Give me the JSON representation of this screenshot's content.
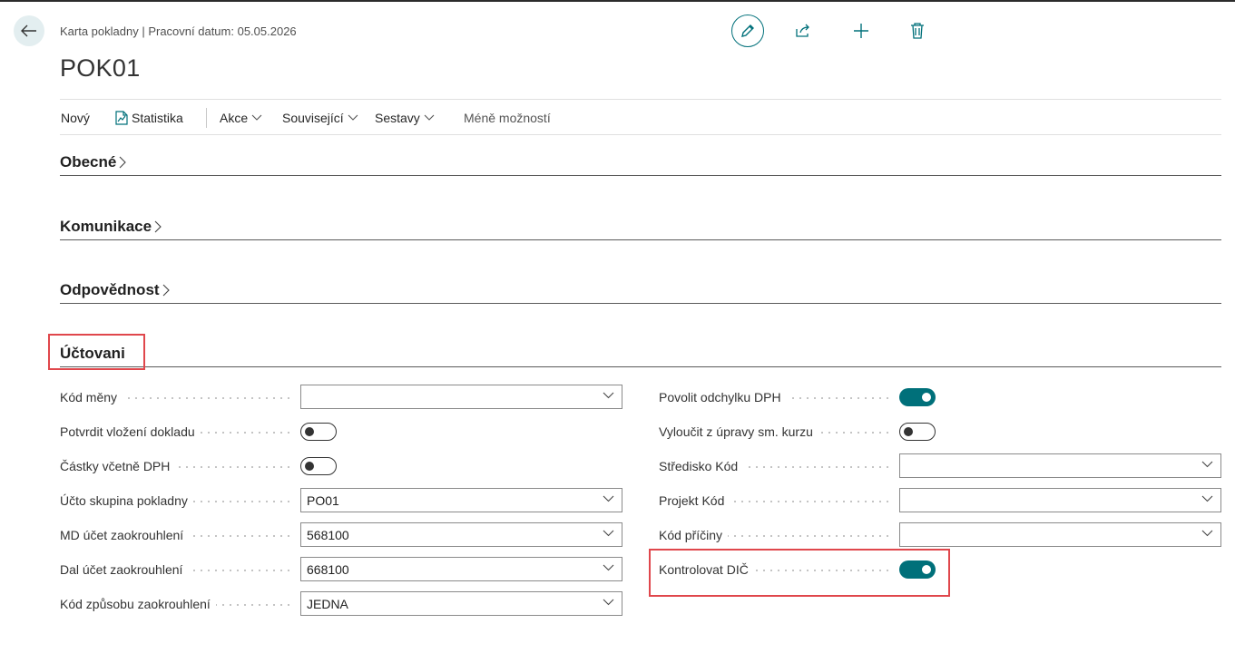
{
  "header": {
    "caption": "Karta pokladny | Pracovní datum: 05.05.2026",
    "title": "POK01"
  },
  "toolbar_icons": [
    "pencil-icon",
    "share-icon",
    "plus-icon",
    "trash-icon"
  ],
  "actions": {
    "new": "Nový",
    "statistics": "Statistika",
    "actions": "Akce",
    "related": "Související",
    "reports": "Sestavy",
    "fewer_options": "Méně možností"
  },
  "sections": {
    "general": "Obecné",
    "communication": "Komunikace",
    "responsibility": "Odpovědnost",
    "posting": "Účtovani"
  },
  "posting": {
    "left": [
      {
        "label": "Kód měny",
        "type": "select",
        "value": ""
      },
      {
        "label": "Potvrdit vložení dokladu",
        "type": "toggle",
        "value": false
      },
      {
        "label": "Částky včetně DPH",
        "type": "toggle",
        "value": false
      },
      {
        "label": "Účto skupina pokladny",
        "type": "select",
        "value": "PO01"
      },
      {
        "label": "MD účet zaokrouhlení",
        "type": "select",
        "value": "568100"
      },
      {
        "label": "Dal účet zaokrouhlení",
        "type": "select",
        "value": "668100"
      },
      {
        "label": "Kód způsobu zaokrouhlení",
        "type": "select",
        "value": "JEDNA"
      }
    ],
    "right": [
      {
        "label": "Povolit odchylku DPH",
        "type": "toggle",
        "value": true
      },
      {
        "label": "Vyloučit z úpravy sm. kurzu",
        "type": "toggle",
        "value": false
      },
      {
        "label": "Středisko Kód",
        "type": "select",
        "value": ""
      },
      {
        "label": "Projekt Kód",
        "type": "select",
        "value": ""
      },
      {
        "label": "Kód příčiny",
        "type": "select",
        "value": ""
      },
      {
        "label": "Kontrolovat DIČ",
        "type": "toggle",
        "value": true
      }
    ]
  },
  "colors": {
    "accent": "#00707a",
    "highlight": "#e0474c"
  }
}
